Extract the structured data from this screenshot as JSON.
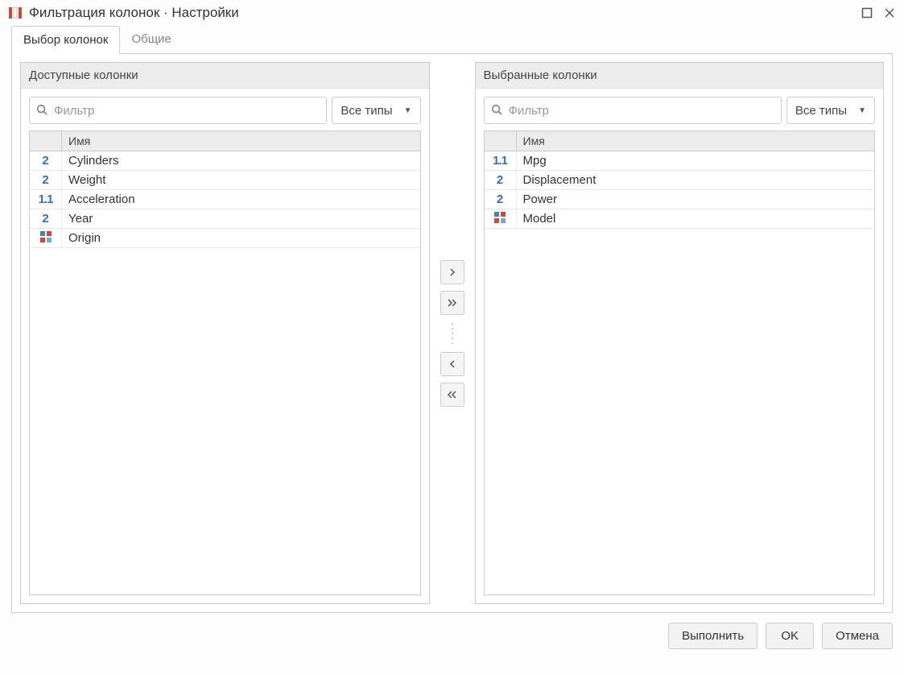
{
  "title": "Фильтрация колонок · Настройки",
  "tabs": [
    {
      "label": "Выбор колонок",
      "active": true
    },
    {
      "label": "Общие",
      "active": false
    }
  ],
  "left_panel": {
    "title": "Доступные колонки",
    "filter_placeholder": "Фильтр",
    "type_select": "Все типы",
    "column_header": "Имя",
    "rows": [
      {
        "name": "Cylinders",
        "type": "int"
      },
      {
        "name": "Weight",
        "type": "int"
      },
      {
        "name": "Acceleration",
        "type": "double"
      },
      {
        "name": "Year",
        "type": "int"
      },
      {
        "name": "Origin",
        "type": "category"
      }
    ]
  },
  "right_panel": {
    "title": "Выбранные колонки",
    "filter_placeholder": "Фильтр",
    "type_select": "Все типы",
    "column_header": "Имя",
    "rows": [
      {
        "name": "Mpg",
        "type": "double"
      },
      {
        "name": "Displacement",
        "type": "int"
      },
      {
        "name": "Power",
        "type": "int"
      },
      {
        "name": "Model",
        "type": "category"
      }
    ]
  },
  "buttons": {
    "execute": "Выполнить",
    "ok": "OK",
    "cancel": "Отмена"
  }
}
